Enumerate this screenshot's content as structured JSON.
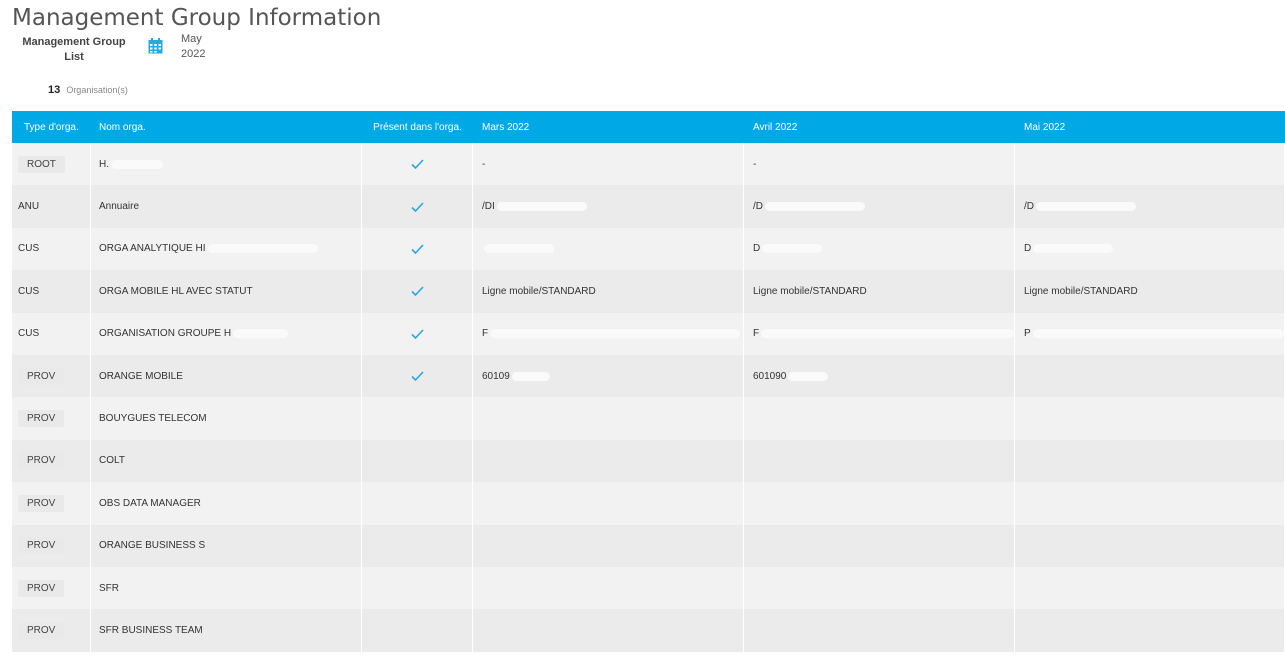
{
  "page": {
    "title": "Management Group Information",
    "list_label": "Management Group List",
    "month": {
      "name": "May",
      "year": "2022"
    },
    "count": {
      "value": "13",
      "unit": "Organisation(s)"
    }
  },
  "colors": {
    "header": "#00a9e6",
    "check": "#2aa7df"
  },
  "table": {
    "headers": {
      "type": "Type d'orga.",
      "name": "Nom orga.",
      "present": "Présent dans l'orga.",
      "m1": "Mars 2022",
      "m2": "Avril 2022",
      "m3": "Mai 2022"
    },
    "rows": [
      {
        "type": "ROOT",
        "name": "H.",
        "present": true,
        "m1": "-",
        "m2": "-",
        "m3": ""
      },
      {
        "type": "ANU",
        "name": "Annuaire",
        "present": true,
        "m1": "/DI",
        "m2": "/D",
        "m3": "/D"
      },
      {
        "type": "CUS",
        "name": "ORGA ANALYTIQUE HI",
        "present": true,
        "m1": "",
        "m2": "D",
        "m3": "D"
      },
      {
        "type": "CUS",
        "name": "ORGA MOBILE HL        AVEC STATUT",
        "present": true,
        "m1": "Ligne mobile/STANDARD",
        "m2": "Ligne mobile/STANDARD",
        "m3": "Ligne mobile/STANDARD"
      },
      {
        "type": "CUS",
        "name": "ORGANISATION GROUPE H",
        "present": true,
        "m1": "F",
        "m2": "F",
        "m3": "P"
      },
      {
        "type": "PROV",
        "name": "ORANGE MOBILE",
        "present": true,
        "m1": "60109",
        "m2": "601090",
        "m3": ""
      },
      {
        "type": "PROV",
        "name": "BOUYGUES TELECOM",
        "present": false,
        "m1": "",
        "m2": "",
        "m3": ""
      },
      {
        "type": "PROV",
        "name": "COLT",
        "present": false,
        "m1": "",
        "m2": "",
        "m3": ""
      },
      {
        "type": "PROV",
        "name": "OBS DATA MANAGER",
        "present": false,
        "m1": "",
        "m2": "",
        "m3": ""
      },
      {
        "type": "PROV",
        "name": "ORANGE BUSINESS S",
        "present": false,
        "m1": "",
        "m2": "",
        "m3": ""
      },
      {
        "type": "PROV",
        "name": "SFR",
        "present": false,
        "m1": "",
        "m2": "",
        "m3": ""
      },
      {
        "type": "PROV",
        "name": "SFR BUSINESS TEAM",
        "present": false,
        "m1": "",
        "m2": "",
        "m3": ""
      }
    ]
  }
}
